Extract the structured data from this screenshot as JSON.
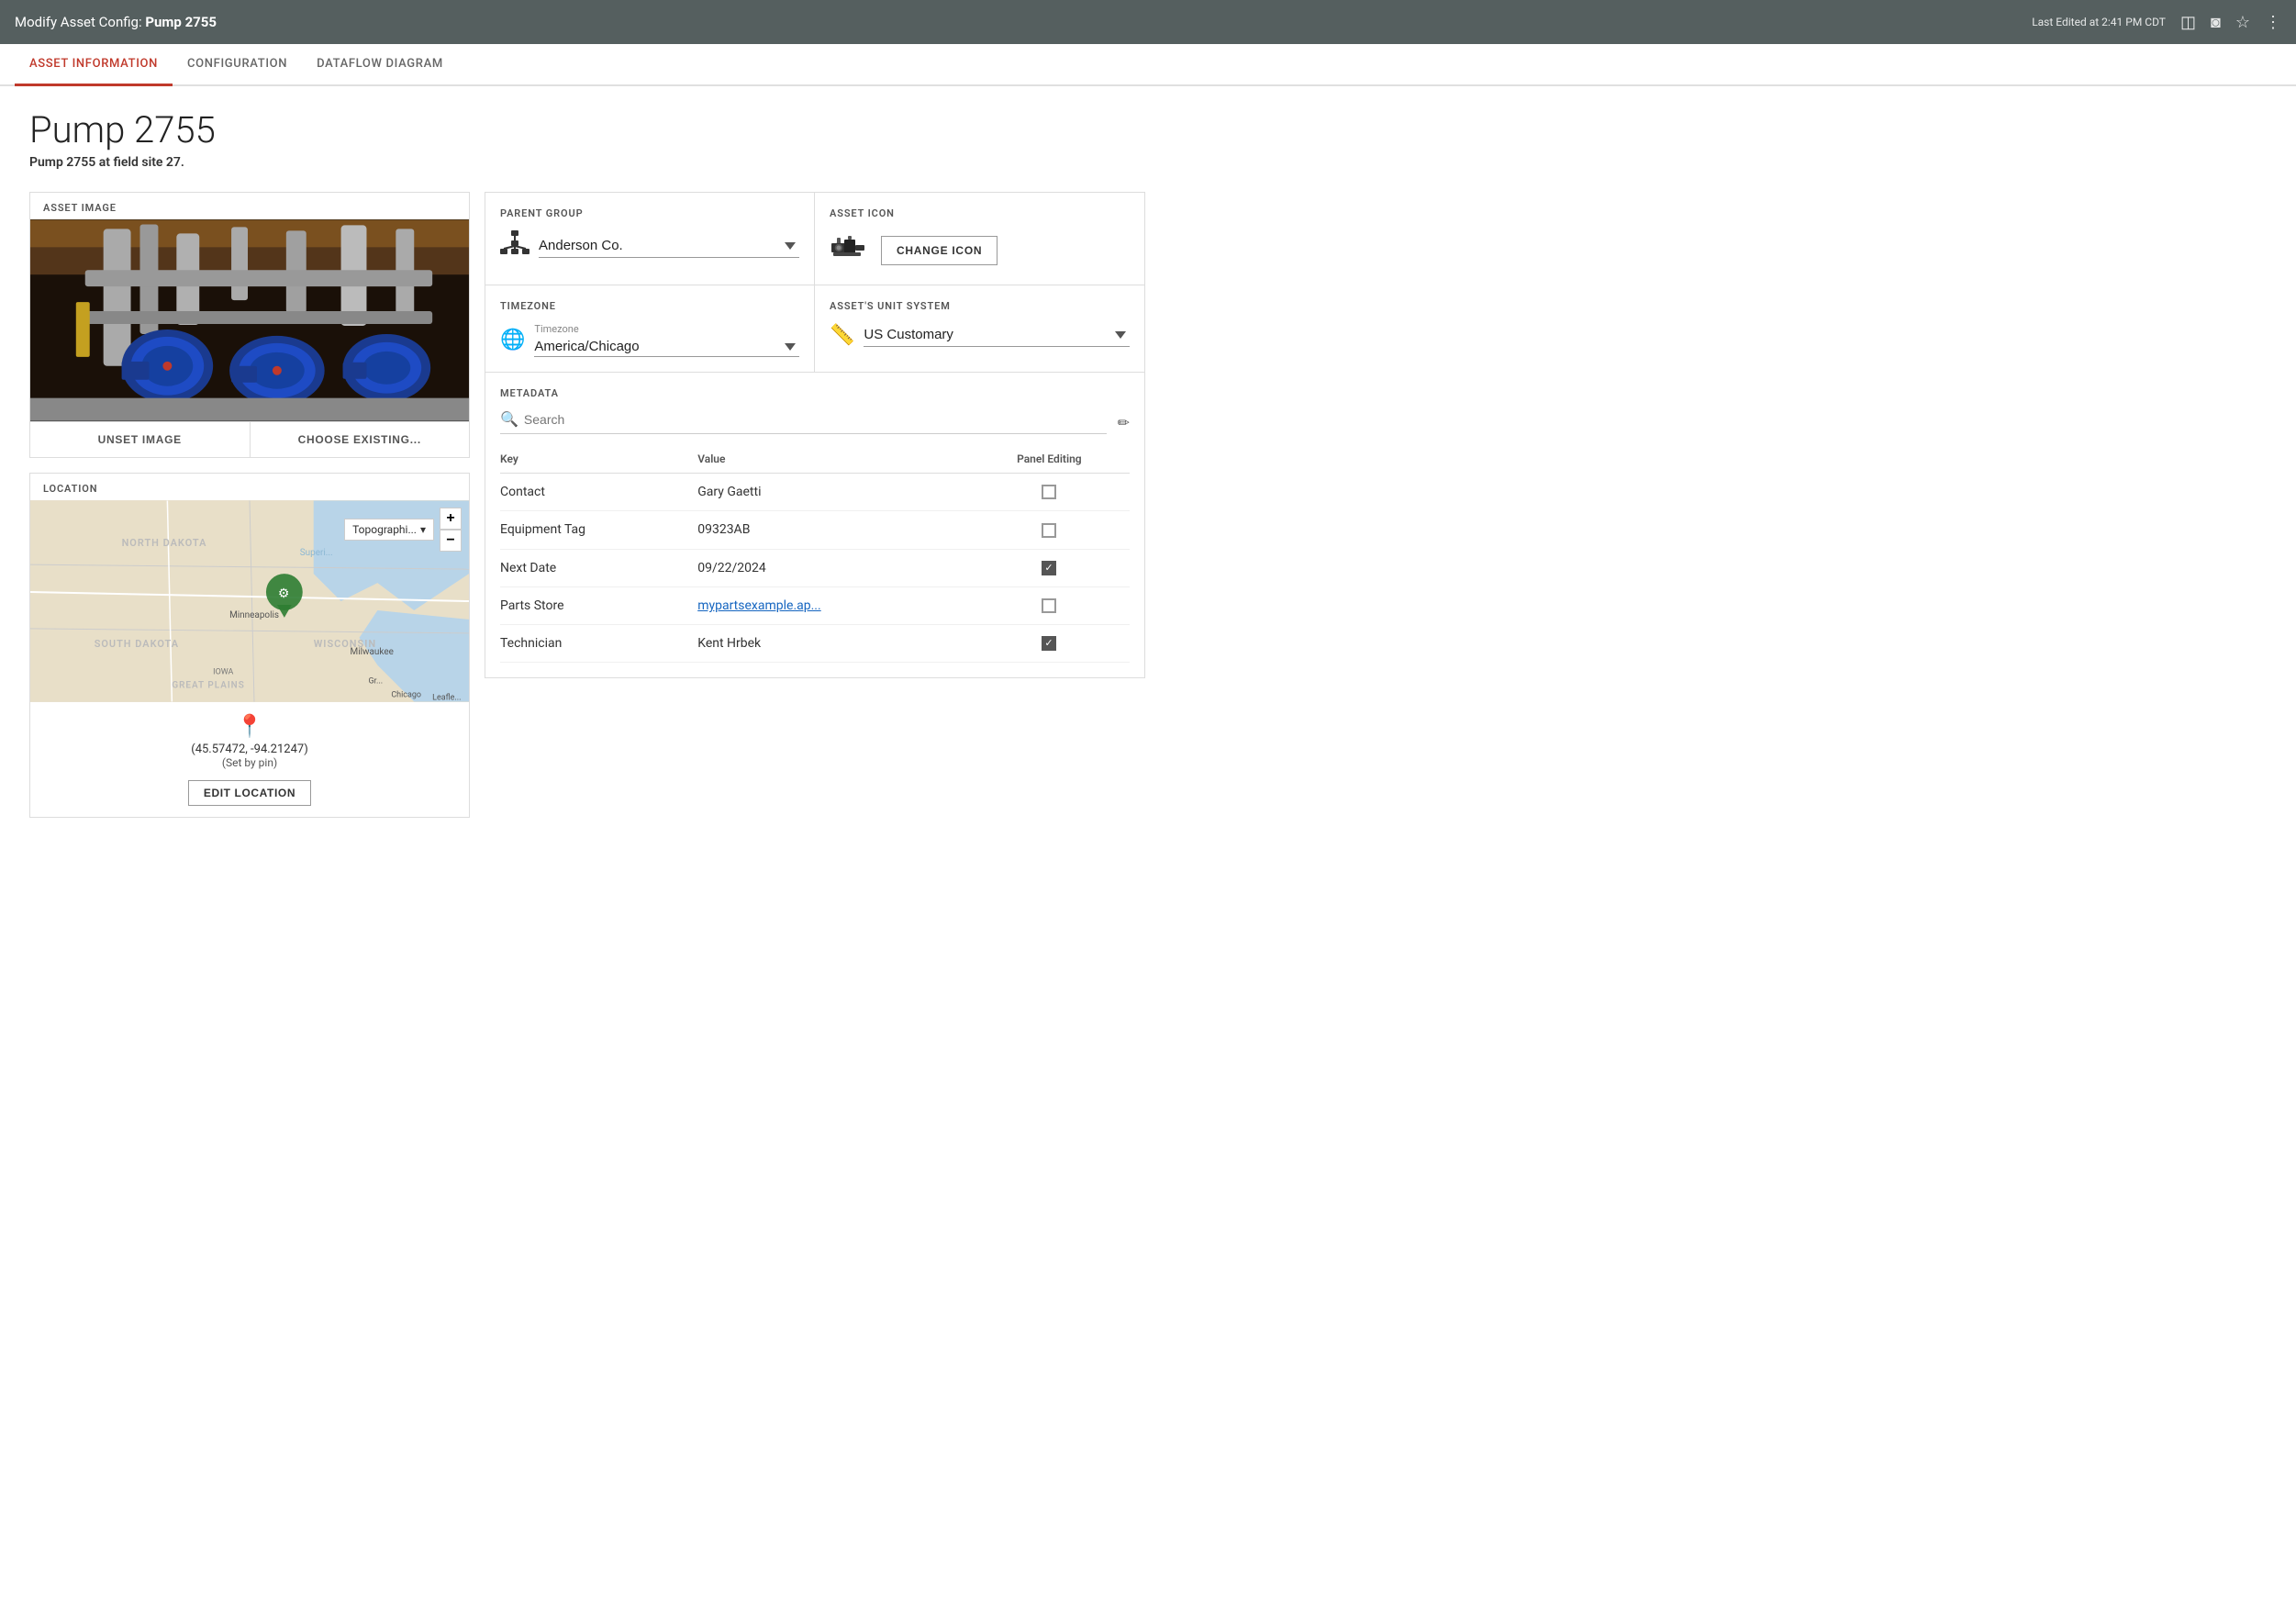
{
  "topbar": {
    "title_prefix": "Modify Asset Config: ",
    "title_asset": "Pump 2755",
    "last_edited": "Last Edited at 2:41 PM CDT"
  },
  "tabs": [
    {
      "id": "asset-info",
      "label": "ASSET INFORMATION",
      "active": true
    },
    {
      "id": "configuration",
      "label": "CONFIGURATION",
      "active": false
    },
    {
      "id": "dataflow",
      "label": "DATAFLOW DIAGRAM",
      "active": false
    }
  ],
  "asset": {
    "title": "Pump 2755",
    "subtitle": "Pump 2755 at field site 27."
  },
  "asset_image": {
    "section_label": "ASSET IMAGE",
    "unset_button": "UNSET IMAGE",
    "choose_button": "CHOOSE EXISTING..."
  },
  "location": {
    "section_label": "LOCATION",
    "map_type": "Topographi...",
    "zoom_in": "+",
    "zoom_out": "−",
    "coords": "(45.57472, -94.21247)",
    "set_by": "(Set by pin)",
    "edit_button": "EDIT LOCATION"
  },
  "parent_group": {
    "section_label": "PARENT GROUP",
    "value": "Anderson Co.",
    "icon": "🖧"
  },
  "asset_icon": {
    "section_label": "ASSET ICON",
    "change_button": "CHANGE ICON"
  },
  "timezone": {
    "section_label": "TIMEZONE",
    "label": "Timezone",
    "value": "America/Chicago"
  },
  "unit_system": {
    "section_label": "ASSET'S UNIT SYSTEM",
    "value": "US Customary"
  },
  "metadata": {
    "section_label": "METADATA",
    "search_placeholder": "Search",
    "columns": {
      "key": "Key",
      "value": "Value",
      "panel_editing": "Panel Editing"
    },
    "rows": [
      {
        "key": "Contact",
        "value": "Gary Gaetti",
        "link": false,
        "checked": false
      },
      {
        "key": "Equipment Tag",
        "value": "09323AB",
        "link": false,
        "checked": false
      },
      {
        "key": "Next Date",
        "value": "09/22/2024",
        "link": false,
        "checked": true
      },
      {
        "key": "Parts Store",
        "value": "mypartsexample.ap...",
        "link": true,
        "checked": false
      },
      {
        "key": "Technician",
        "value": "Kent Hrbek",
        "link": false,
        "checked": true
      }
    ]
  }
}
